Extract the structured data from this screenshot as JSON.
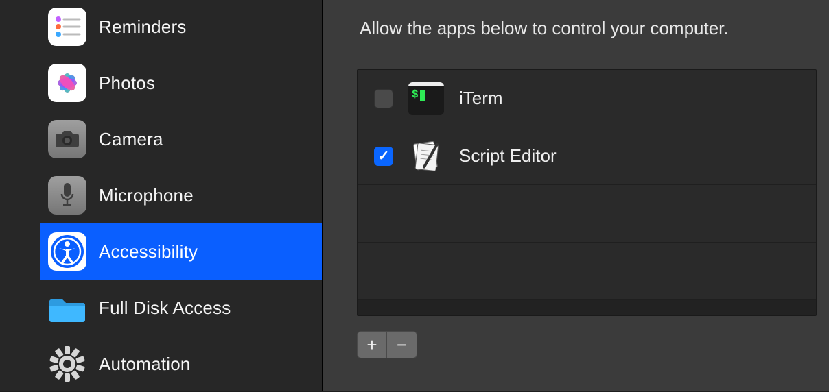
{
  "sidebar": {
    "items": [
      {
        "label": "Reminders",
        "icon": "reminders-icon",
        "selected": false
      },
      {
        "label": "Photos",
        "icon": "photos-icon",
        "selected": false
      },
      {
        "label": "Camera",
        "icon": "camera-icon",
        "selected": false
      },
      {
        "label": "Microphone",
        "icon": "microphone-icon",
        "selected": false
      },
      {
        "label": "Accessibility",
        "icon": "accessibility-icon",
        "selected": true
      },
      {
        "label": "Full Disk Access",
        "icon": "folder-icon",
        "selected": false
      },
      {
        "label": "Automation",
        "icon": "gear-icon",
        "selected": false
      }
    ]
  },
  "main": {
    "description": "Allow the apps below to control your computer.",
    "apps": [
      {
        "name": "iTerm",
        "checked": false,
        "icon": "iterm-icon"
      },
      {
        "name": "Script Editor",
        "checked": true,
        "icon": "script-editor-icon"
      }
    ],
    "buttons": {
      "add": "+",
      "remove": "−"
    }
  },
  "colors": {
    "selection": "#0a5fff",
    "checkbox_checked": "#0a66ff"
  }
}
